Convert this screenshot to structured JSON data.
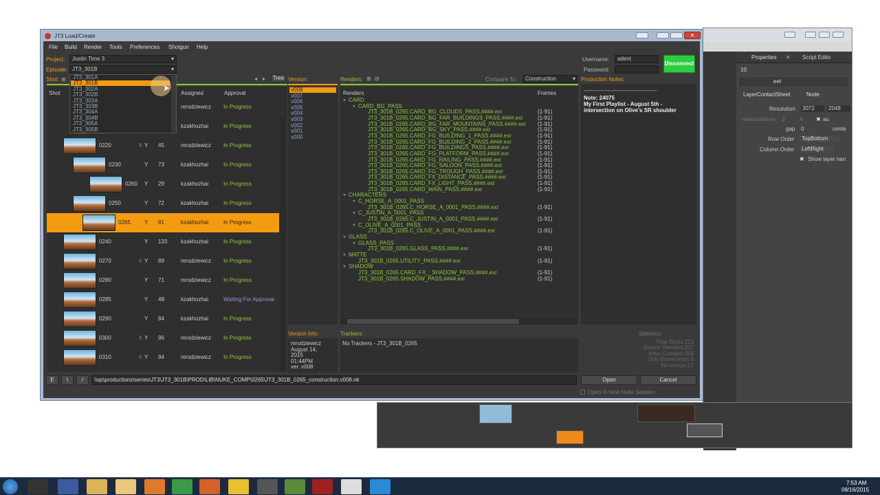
{
  "dialog": {
    "title": "JT3 Load/Create"
  },
  "menu": [
    "File",
    "Build",
    "Render",
    "Tools",
    "Preferences",
    "Shotgun",
    "Help"
  ],
  "project": {
    "label": "Project:",
    "value": "Justin Time 3"
  },
  "episode": {
    "label": "Episode:",
    "value": "JT3_301B"
  },
  "shot": {
    "label": "Shot:"
  },
  "episode_dropdown": [
    "JT3_301A",
    "JT3_301B",
    "JT3_302A",
    "JT3_302B",
    "JT3_303A",
    "JT3_303B",
    "JT3_304A",
    "JT3_304B",
    "JT3_305A",
    "JT3_305B"
  ],
  "tree_button": "Tree",
  "shot_table": {
    "headers": [
      "Shot",
      "Assigned",
      "Approval"
    ],
    "rows": [
      {
        "shot": "",
        "flag": "",
        "y": "",
        "num": "",
        "assigned": "mrodziewicz",
        "approval": "In Progress"
      },
      {
        "shot": "",
        "flag": "",
        "y": "",
        "num": "",
        "assigned": "kzakhozhai",
        "approval": "In Progress"
      },
      {
        "shot": "0220",
        "flag": "K",
        "y": "Y",
        "num": "45",
        "assigned": "mrodziewicz",
        "approval": "In Progress"
      },
      {
        "shot": "0230",
        "flag": "",
        "y": "Y",
        "num": "73",
        "assigned": "kzakhozhai",
        "approval": "In Progress"
      },
      {
        "shot": "0260",
        "flag": "",
        "y": "Y",
        "num": "29",
        "assigned": "kzakhozhai",
        "approval": "In Progress"
      },
      {
        "shot": "0250",
        "flag": "",
        "y": "Y",
        "num": "72",
        "assigned": "kzakhozhai",
        "approval": "In Progress"
      },
      {
        "shot": "0265",
        "flag": "",
        "y": "Y",
        "num": "91",
        "assigned": "kzakhozhai",
        "approval": "In Progress"
      },
      {
        "shot": "0240",
        "flag": "",
        "y": "Y",
        "num": "133",
        "assigned": "kzakhozhai",
        "approval": "In Progress"
      },
      {
        "shot": "0270",
        "flag": "K",
        "y": "Y",
        "num": "89",
        "assigned": "mrodziewicz",
        "approval": "In Progress"
      },
      {
        "shot": "0280",
        "flag": "",
        "y": "Y",
        "num": "71",
        "assigned": "mrodziewicz",
        "approval": "In Progress"
      },
      {
        "shot": "0285",
        "flag": "",
        "y": "Y",
        "num": "48",
        "assigned": "kzakhozhai",
        "approval": "Waiting For Approval"
      },
      {
        "shot": "0290",
        "flag": "",
        "y": "Y",
        "num": "84",
        "assigned": "kzakhozhai",
        "approval": "In Progress"
      },
      {
        "shot": "0300",
        "flag": "K",
        "y": "Y",
        "num": "96",
        "assigned": "mrodziewicz",
        "approval": "In Progress"
      },
      {
        "shot": "0310",
        "flag": "K",
        "y": "Y",
        "num": "94",
        "assigned": "mrodziewicz",
        "approval": "In Progress"
      }
    ]
  },
  "version": {
    "label": "Version:",
    "items": [
      "v008",
      "v007",
      "v006",
      "v005",
      "v004",
      "v003",
      "v002",
      "v001",
      "v000"
    ],
    "info_label": "Version Info:",
    "info": [
      "mrodziewicz",
      "August 14,",
      "2015",
      "01:44PM",
      "ver. v008"
    ]
  },
  "renders": {
    "label": "Renders:",
    "compare_label": "Compare To:",
    "compare_value": "Construction",
    "col_renders": "Renders",
    "col_frames": "Frames",
    "tree": [
      {
        "t": "CARD",
        "lvl": 0,
        "f": ""
      },
      {
        "t": "CARD_BG_PASS",
        "lvl": 1,
        "f": ""
      },
      {
        "t": "JT3_301B_0265.CARD_BG_CLOUDS_PASS.####.exr",
        "lvl": 2,
        "f": "(1-91)"
      },
      {
        "t": "JT3_301B_0265.CARD_BG_FAR_BUILDINGS_PASS.####.exr",
        "lvl": 2,
        "f": "(1-91)"
      },
      {
        "t": "JT3_301B_0265.CARD_BG_FAR_MOUNTAINS_PASS.####.exr",
        "lvl": 2,
        "f": "(1-91)"
      },
      {
        "t": "JT3_301B_0265.CARD_BG_SKY_PASS.####.exr",
        "lvl": 2,
        "f": "(1-91)"
      },
      {
        "t": "JT3_301B_0265.CARD_FG_BUILDING_1_PASS.####.exr",
        "lvl": 2,
        "f": "(1-91)"
      },
      {
        "t": "JT3_301B_0265.CARD_FG_BUILDING_2_PASS.####.exr",
        "lvl": 2,
        "f": "(1-91)"
      },
      {
        "t": "JT3_301B_0265.CARD_FG_BUILDINGS_PASS.####.exr",
        "lvl": 2,
        "f": "(1-91)"
      },
      {
        "t": "JT3_301B_0265.CARD_FG_PLATFORM_PASS.####.exr",
        "lvl": 2,
        "f": "(1-91)"
      },
      {
        "t": "JT3_301B_0265.CARD_FG_RAILING_PASS.####.exr",
        "lvl": 2,
        "f": "(1-91)"
      },
      {
        "t": "JT3_301B_0265.CARD_FG_SALOON_PASS.####.exr",
        "lvl": 2,
        "f": "(1-91)"
      },
      {
        "t": "JT3_301B_0265.CARD_FG_TROUGH_PASS.####.exr",
        "lvl": 2,
        "f": "(1-91)"
      },
      {
        "t": "JT3_301B_0265.CARD_FX_DISTANCE_PASS.####.exr",
        "lvl": 2,
        "f": "(1-91)"
      },
      {
        "t": "JT3_301B_0265.CARD_FX_LIGHT_PASS.####.exr",
        "lvl": 2,
        "f": "(1-91)"
      },
      {
        "t": "JT3_301B_0265.CARD_MAIN_PASS.####.exr",
        "lvl": 2,
        "f": "(1-91)"
      },
      {
        "t": "CHARACTERS",
        "lvl": 0,
        "f": ""
      },
      {
        "t": "C_HORSE_A_0001_PASS",
        "lvl": 1,
        "f": ""
      },
      {
        "t": "JT3_301B_0265.C_HORSE_A_0001_PASS.####.exr",
        "lvl": 2,
        "f": "(1-91)"
      },
      {
        "t": "C_JUSTIN_A_0001_PASS",
        "lvl": 1,
        "f": ""
      },
      {
        "t": "JT3_301B_0265.C_JUSTIN_A_0001_PASS.####.exr",
        "lvl": 2,
        "f": "(1-91)"
      },
      {
        "t": "C_OLIVE_A_0001_PASS",
        "lvl": 1,
        "f": ""
      },
      {
        "t": "JT3_301B_0265.C_OLIVE_A_0001_PASS.####.exr",
        "lvl": 2,
        "f": "(1-91)"
      },
      {
        "t": "GLASS",
        "lvl": 0,
        "f": ""
      },
      {
        "t": "GLASS_PASS",
        "lvl": 1,
        "f": ""
      },
      {
        "t": "JT3_301B_0265.GLASS_PASS.####.exr",
        "lvl": 2,
        "f": "(1-91)"
      },
      {
        "t": "MATTE",
        "lvl": 0,
        "f": ""
      },
      {
        "t": "JT3_301B_0265.UTILITY_PASS.####.exr",
        "lvl": 1,
        "f": "(1-91)"
      },
      {
        "t": "SHADOW",
        "lvl": 0,
        "f": ""
      },
      {
        "t": "JT3_301B_0265.CARD_FX__SHADOW_PASS.####.exr",
        "lvl": 1,
        "f": "(1-91)"
      },
      {
        "t": "JT3_301B_0265.SHADOW_PASS.####.exr",
        "lvl": 1,
        "f": "(1-91)"
      }
    ]
  },
  "trackers": {
    "label": "Trackers:",
    "text": "No Trackers - JT3_301B_0265"
  },
  "login": {
    "username_label": "Username:",
    "username_value": "adent",
    "password_label": "Password:",
    "disconnect": "Disconnect"
  },
  "notes": {
    "label": "Production Notes:",
    "divider": "----------------------------------------",
    "note": "Note: 24075",
    "line1": "My First Playlist - August 5th -",
    "line2": "intersection on Olive's SR shoulder"
  },
  "stats": {
    "label": "Statistics:",
    "lines": [
      "Total Shots:223",
      "Source Renders:207",
      "Artist Comped:208",
      "Only Basecomps:0",
      "No comps:17"
    ]
  },
  "path_buttons": [
    "E",
    "\\",
    "/"
  ],
  "path": "\\\\qs\\productions\\series\\JT3\\JT3_301B\\PROD\\LIB\\NUKE_COMP\\0265\\JT3_301B_0265_construction.v008.nk",
  "open_label": "Open",
  "cancel_label": "Cancel",
  "new_session": "Open in New Nuke Session",
  "bg_nuke": {
    "properties_tab": "Properties",
    "script_tab": "Script Edito",
    "num": "10",
    "node_name": "eet",
    "tab1": "LayerContactSheet",
    "tab2": "Node",
    "resolution_label": "Resolution",
    "res_w": "3072",
    "res_h": "2048",
    "rows_label": "rows/columns",
    "rows_a": "3",
    "rows_b": "4",
    "auto": "au",
    "gap_label": "gap",
    "gap": "0",
    "center": "cente",
    "row_order_label": "Row Order",
    "row_order": "TopBottom",
    "col_order_label": "Column Order",
    "col_order": "LeftRight",
    "show_layer": "Show layer nan"
  },
  "clock": {
    "time": "7:53 AM",
    "date": "08/16/2015"
  }
}
